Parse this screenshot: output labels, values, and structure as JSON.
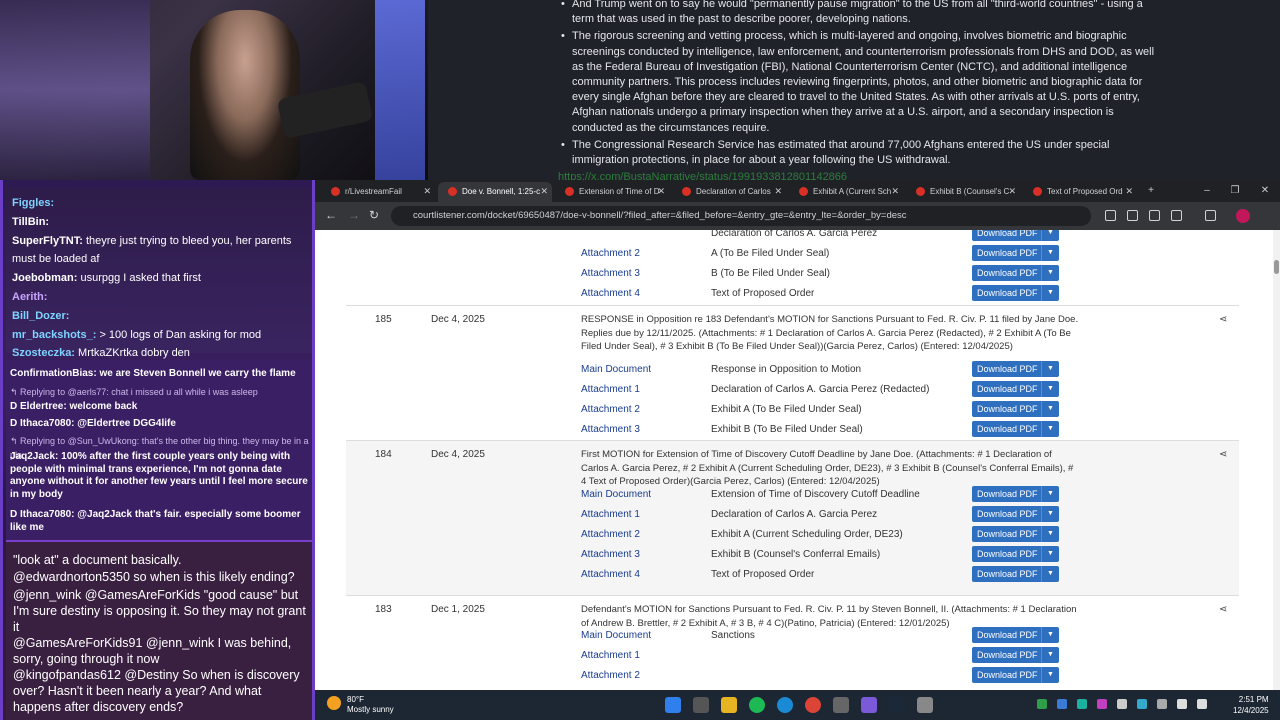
{
  "article": {
    "items": [
      "And Trump went on to say he would \"permanently pause migration\" to the US from all \"third-world countries\" - using a term that was used in the past to describe poorer, developing nations.",
      "The rigorous screening and vetting process, which is multi-layered and ongoing, involves biometric and biographic screenings conducted by intelligence, law enforcement, and counterterrorism professionals from DHS and DOD, as well as the Federal Bureau of Investigation (FBI), National Counterterrorism Center (NCTC), and additional intelligence community partners. This process includes reviewing fingerprints, photos, and other biometric and biographic data for every single Afghan before they are cleared to travel to the United States. As with other arrivals at U.S. ports of entry, Afghan nationals undergo a primary inspection when they arrive at a U.S. airport, and a secondary inspection is conducted as the circumstances require.",
      "The Congressional Research Service has estimated that around 77,000 Afghans entered the US under special immigration protections, in place for about a year following the US withdrawal."
    ],
    "link": "https://x.com/BustaNarrative/status/1991933812801142866"
  },
  "chat": {
    "top": [
      {
        "user": "Figgles:",
        "msg": "",
        "color": "#7fd3ff"
      },
      {
        "user": "TillBin:",
        "msg": "",
        "color": "#ffffff"
      },
      {
        "user": "SuperFlyTNT:",
        "msg": "theyre just trying to bleed you, her parents",
        "color": "#ffffff"
      },
      {
        "user": "",
        "msg": "must be loaded af",
        "color": "#ffffff"
      },
      {
        "user": "Joebobman:",
        "msg": "usurpgg I asked that first",
        "color": "#ffffff"
      },
      {
        "user": "Aerith:",
        "msg": "",
        "color": "#c9a4ff"
      },
      {
        "user": "Bill_Dozer:",
        "msg": "",
        "color": "#7fd3ff"
      },
      {
        "user": "mr_backshots_:",
        "msg": "> 100 logs of Dan asking for mod",
        "color": "#7fd3ff"
      },
      {
        "user": "Szosteczka:",
        "msg": "MrtkaZKrtka dobry den",
        "color": "#7fd3ff"
      }
    ],
    "mid": [
      {
        "text": "ConfirmationBias: we are Steven Bonnell we carry the flame",
        "reply": false
      },
      {
        "text": "↰ Replying to @aerls77: chat i missed u all while i was asleep",
        "reply": true
      },
      {
        "text": "D Eldertree: welcome back",
        "reply": false
      },
      {
        "text": "D Ithaca7080: @Eldertree DGG4life",
        "reply": false
      },
      {
        "text": "↰ Replying to @Sun_UwUkong: that's the other big thing. they may be in a pla...",
        "reply": true
      },
      {
        "text": "Jaq2Jack: 100% after the first couple years only being with people with minimal trans experience, I'm not gonna date anyone without it for another few years until I feel more secure in my body",
        "reply": false
      },
      {
        "text": "D Ithaca7080: @Jaq2Jack that's fair. especially some boomer like me",
        "reply": false
      }
    ],
    "bottom": [
      "\"look at\" a document basically.",
      "@edwardnorton5350 so when is this likely ending?",
      "@jenn_wink @GamesAreForKids \"good cause\" but I'm sure destiny is opposing it. So they may not grant it",
      "@GamesAreForKids91 @jenn_wink I was behind, sorry, going through it now",
      "@kingofpandas612 @Destiny So when is discovery over? Hasn't it been nearly a year? And what happens after discovery ends?"
    ]
  },
  "browser": {
    "tabs": [
      {
        "label": "r/LivestreamFail",
        "active": false
      },
      {
        "label": "Doe v. Bonnell, 1:25-c",
        "active": true
      },
      {
        "label": "Extension of Time of D",
        "active": false
      },
      {
        "label": "Declaration of Carlos",
        "active": false
      },
      {
        "label": "Exhibit A (Current Sch",
        "active": false
      },
      {
        "label": "Exhibit B (Counsel's C",
        "active": false
      },
      {
        "label": "Text of Proposed Ord",
        "active": false
      }
    ],
    "url": "courtlistener.com/docket/69650487/doe-v-bonnell/?filed_after=&filed_before=&entry_gte=&entry_lte=&order_by=desc",
    "download_label": "Download PDF"
  },
  "docket": {
    "top_attachments": [
      {
        "name": "Attachment 2",
        "desc": "A (To Be Filed Under Seal)"
      },
      {
        "name": "Attachment 3",
        "desc": "B (To Be Filed Under Seal)"
      },
      {
        "name": "Attachment 4",
        "desc": "Text of Proposed Order"
      }
    ],
    "top_partial": "Declaration of Carlos A. Garcia Perez",
    "entries": [
      {
        "num": "185",
        "date": "Dec 4, 2025",
        "desc": "RESPONSE in Opposition re 183 Defendant's MOTION for Sanctions Pursuant to Fed. R. Civ. P. 11 filed by Jane Doe. Replies due by 12/11/2025. (Attachments: # 1 Declaration of Carlos A. Garcia Perez (Redacted), # 2 Exhibit A (To Be Filed Under Seal), # 3 Exhibit B (To Be Filed Under Seal))(Garcia Perez, Carlos) (Entered: 12/04/2025)",
        "attachments": [
          {
            "name": "Main Document",
            "desc": "Response in Opposition to Motion"
          },
          {
            "name": "Attachment 1",
            "desc": "Declaration of Carlos A. Garcia Perez (Redacted)"
          },
          {
            "name": "Attachment 2",
            "desc": "Exhibit A (To Be Filed Under Seal)"
          },
          {
            "name": "Attachment 3",
            "desc": "Exhibit B (To Be Filed Under Seal)"
          }
        ]
      },
      {
        "num": "184",
        "date": "Dec 4, 2025",
        "desc": "First MOTION for Extension of Time of Discovery Cutoff Deadline by Jane Doe. (Attachments: # 1 Declaration of Carlos A. Garcia Perez, # 2 Exhibit A (Current Scheduling Order, DE23), # 3 Exhibit B (Counsel's Conferral Emails), # 4 Text of Proposed Order)(Garcia Perez, Carlos) (Entered: 12/04/2025)",
        "attachments": [
          {
            "name": "Main Document",
            "desc": "Extension of Time of Discovery Cutoff Deadline"
          },
          {
            "name": "Attachment 1",
            "desc": "Declaration of Carlos A. Garcia Perez"
          },
          {
            "name": "Attachment 2",
            "desc": "Exhibit A (Current Scheduling Order, DE23)"
          },
          {
            "name": "Attachment 3",
            "desc": "Exhibit B (Counsel's Conferral Emails)"
          },
          {
            "name": "Attachment 4",
            "desc": "Text of Proposed Order"
          }
        ]
      },
      {
        "num": "183",
        "date": "Dec 1, 2025",
        "desc": "Defendant's MOTION for Sanctions Pursuant to Fed. R. Civ. P. 11 by Steven Bonnell, II. (Attachments: # 1 Declaration of Andrew B. Brettler, # 2 Exhibit A, # 3 B, # 4 C)(Patino, Patricia) (Entered: 12/01/2025)",
        "attachments": [
          {
            "name": "Main Document",
            "desc": "Sanctions"
          },
          {
            "name": "Attachment 1",
            "desc": ""
          },
          {
            "name": "Attachment 2",
            "desc": ""
          }
        ]
      }
    ]
  },
  "taskbar": {
    "temp": "80°F",
    "weather": "Mostly sunny",
    "time": "2:51 PM",
    "date": "12/4/2025"
  }
}
